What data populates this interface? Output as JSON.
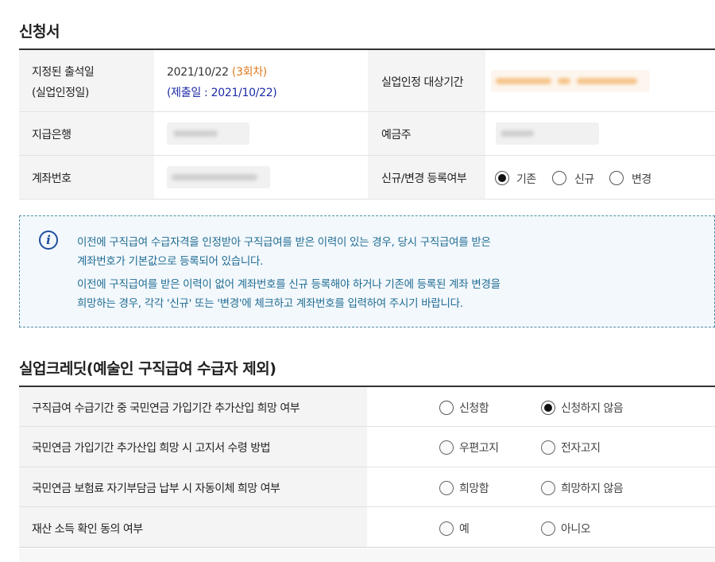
{
  "application": {
    "title": "신청서",
    "rows": [
      {
        "left_label_1": "지정된 출석일",
        "left_label_2": "(실업인정일)",
        "date": "2021/10/22",
        "round": "(3회차)",
        "submitted": "(제출일 : 2021/10/22)",
        "right_label": "실업인정 대상기간"
      },
      {
        "left_label": "지급은행",
        "right_label": "예금주"
      },
      {
        "left_label": "계좌번호",
        "right_label": "신규/변경 등록여부",
        "options": [
          {
            "label": "기존",
            "checked": true
          },
          {
            "label": "신규",
            "checked": false
          },
          {
            "label": "변경",
            "checked": false
          }
        ]
      }
    ]
  },
  "notice": {
    "icon": "info-icon",
    "line1": "이전에 구직급여 수급자격을 인정받아 구직급여를 받은 이력이 있는 경우, 당시 구직급여를 받은",
    "line2": "계좌번호가 기본값으로 등록되어 있습니다.",
    "line3": "이전에 구직급여를 받은 이력이 없어 계좌번호를 신규 등록해야 하거나 기존에 등록된 계좌 변경을",
    "line4": "희망하는 경우, 각각 '신규' 또는 '변경'에 체크하고 계좌번호를 입력하여 주시기 바랍니다."
  },
  "credit": {
    "title": "실업크레딧(예술인 구직급여 수급자 제외)",
    "rows": [
      {
        "label": "구직급여 수급기간 중 국민연금 가입기간 추가산입 희망 여부",
        "opt1": "신청함",
        "opt2": "신청하지 않음",
        "selected": 2
      },
      {
        "label": "국민연금 가입기간 추가산입 희망 시 고지서 수령 방법",
        "opt1": "우편고지",
        "opt2": "전자고지",
        "selected": 0
      },
      {
        "label": "국민연금 보험료 자기부담금 납부 시 자동이체 희망 여부",
        "opt1": "희망함",
        "opt2": "희망하지 않음",
        "selected": 0
      },
      {
        "label": "재산 소득 확인 동의 여부",
        "opt1": "예",
        "opt2": "아니오",
        "selected": 0
      }
    ]
  },
  "colors": {
    "accent_orange": "#e07a1d",
    "link_blue": "#1b2aa6",
    "notice_text": "#1f6c93",
    "notice_border": "#4d8fa8"
  }
}
